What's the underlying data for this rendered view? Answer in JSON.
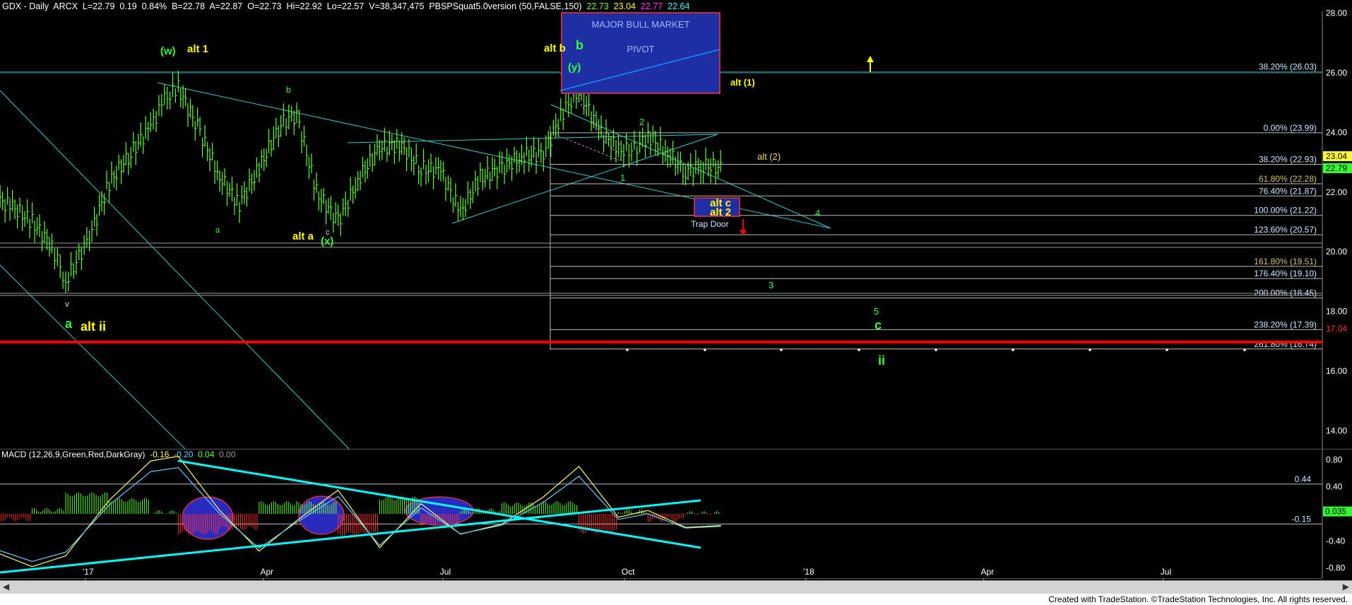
{
  "header": {
    "symbol": "GDX - Daily  ARCX",
    "last": "L=22.79",
    "chg": "0.19",
    "pct": "0.84%",
    "bid": "B=22.78",
    "ask": "A=22.87",
    "open": "O=22.73",
    "hi": "Hi=22.92",
    "lo": "Lo=22.57",
    "vol": "V=38,347,475",
    "study": "PBSPSquat5.0version (50,FALSE,150)",
    "v1": "22.73",
    "v2": "23.04",
    "v3": "22.77",
    "v4": "22.64"
  },
  "macd_header": {
    "name": "MACD (12,26,9,Green,Red,DarkGray)",
    "v1": "-0.16",
    "v2": "-0.20",
    "v3": "0.04",
    "v4": "0.00"
  },
  "footer": "Created with TradeStation. ©TradeStation Technologies, Inc. All rights reserved.",
  "colors": {
    "bg": "#000000",
    "price_bar": "#66ff33",
    "cyan_line": "#33cccc",
    "bright_cyan": "#00ffff",
    "fib_line": "#cccccc",
    "red_line": "#ff0000",
    "yellow": "#ffff00",
    "green_label": "#33ff33",
    "blue_box": "#1d2fa3"
  },
  "chart_data": [
    {
      "type": "line",
      "title": "",
      "ylim": [
        13,
        28
      ],
      "y_ticks": [
        "28.00",
        "26.00",
        "24.00",
        "22.00",
        "20.00",
        "18.00",
        "16.00",
        "14.00"
      ],
      "x_ticks": [
        "'17",
        "Apr",
        "Jul",
        "Oct",
        "'18",
        "Apr",
        "Jul"
      ],
      "series": [
        {
          "x": [
            "2016-11-15",
            "2016-11-25",
            "2016-12-05",
            "2016-12-15",
            "2016-12-22",
            "2017-01-03",
            "2017-01-13",
            "2017-01-24",
            "2017-02-03",
            "2017-02-10",
            "2017-02-17",
            "2017-02-28",
            "2017-03-10",
            "2017-03-20",
            "2017-03-30",
            "2017-04-10",
            "2017-04-18",
            "2017-04-28",
            "2017-05-09",
            "2017-05-19",
            "2017-05-30",
            "2017-06-09",
            "2017-06-20",
            "2017-06-30",
            "2017-07-10",
            "2017-07-20",
            "2017-07-31",
            "2017-08-10",
            "2017-08-21",
            "2017-08-31",
            "2017-09-08",
            "2017-09-18",
            "2017-09-28",
            "2017-10-06",
            "2017-10-13",
            "2017-10-23",
            "2017-11-01",
            "2017-11-10",
            "2017-11-20"
          ],
          "values": [
            21.8,
            21.5,
            21.0,
            20.2,
            19.0,
            20.5,
            22.3,
            23.3,
            24.2,
            25.1,
            25.5,
            24.0,
            22.5,
            21.6,
            22.8,
            24.3,
            24.6,
            22.0,
            21.0,
            22.4,
            23.5,
            23.6,
            22.8,
            22.7,
            21.3,
            22.5,
            22.8,
            23.2,
            23.3,
            24.7,
            25.4,
            24.1,
            23.4,
            23.4,
            23.9,
            23.3,
            22.7,
            22.9,
            22.8
          ]
        }
      ],
      "fib_levels": [
        {
          "pct": "38.20%",
          "value": 26.03
        },
        {
          "pct": "0.00%",
          "value": 23.99
        },
        {
          "pct": "38.20%",
          "value": 22.93
        },
        {
          "pct": "61.80%",
          "value": 22.28
        },
        {
          "pct": "76.40%",
          "value": 21.87
        },
        {
          "pct": "100.00%",
          "value": 21.22
        },
        {
          "pct": "123.60%",
          "value": 20.57
        },
        {
          "pct": "161.80%",
          "value": 19.51
        },
        {
          "pct": "176.40%",
          "value": 19.1
        },
        {
          "pct": "200.00%",
          "value": 18.45
        },
        {
          "pct": "238.20%",
          "value": 17.39
        },
        {
          "pct": "261.80%",
          "value": 16.74
        }
      ],
      "price_labels": [
        "23.04",
        "22.79",
        "17.04"
      ],
      "boxes": [
        {
          "line1": "MAJOR BULL MARKET",
          "line2": "PIVOT"
        },
        {
          "line1": "alt c",
          "line2": "alt 2"
        }
      ],
      "annotations": {
        "w": "(w)",
        "alt1": "alt 1",
        "b_top": "b",
        "a_left": "a",
        "c_small": "c",
        "alt_a": "alt a",
        "x": "(x)",
        "v": "v",
        "a_big": "a",
        "alt_ii": "alt ii",
        "alt_b": "alt b",
        "b_big": "b",
        "y": "(y)",
        "alt_1_paren": "alt (1)",
        "two": "2",
        "one": "1",
        "alt_2_paren": "alt (2)",
        "four": "4",
        "trap_door": "Trap Door",
        "three": "3",
        "five": "5",
        "c_big": "c",
        "ii": "ii"
      }
    },
    {
      "type": "bar",
      "title": "MACD (12,26,9,Green,Red,DarkGray)",
      "ylim": [
        -0.95,
        0.95
      ],
      "y_ticks": [
        "0.80",
        "0.40",
        "-0.40",
        "-0.80"
      ],
      "levels": [
        {
          "label": "0.44",
          "value": 0.44
        },
        {
          "label": "-0.15",
          "value": -0.15
        }
      ],
      "price_label": "0.035",
      "series": [
        {
          "name": "macd",
          "x": [
            "2016-11-15",
            "2016-12-05",
            "2016-12-22",
            "2017-01-13",
            "2017-02-03",
            "2017-02-17",
            "2017-03-10",
            "2017-03-30",
            "2017-04-18",
            "2017-05-09",
            "2017-05-30",
            "2017-06-20",
            "2017-07-10",
            "2017-07-31",
            "2017-08-21",
            "2017-09-08",
            "2017-09-28",
            "2017-10-13",
            "2017-11-01",
            "2017-11-20"
          ],
          "values": [
            -0.55,
            -0.78,
            -0.62,
            0.2,
            0.78,
            0.85,
            0.05,
            -0.55,
            -0.1,
            0.35,
            -0.5,
            0.15,
            -0.3,
            -0.15,
            0.25,
            0.7,
            -0.05,
            0.05,
            -0.2,
            -0.17
          ]
        }
      ]
    }
  ]
}
